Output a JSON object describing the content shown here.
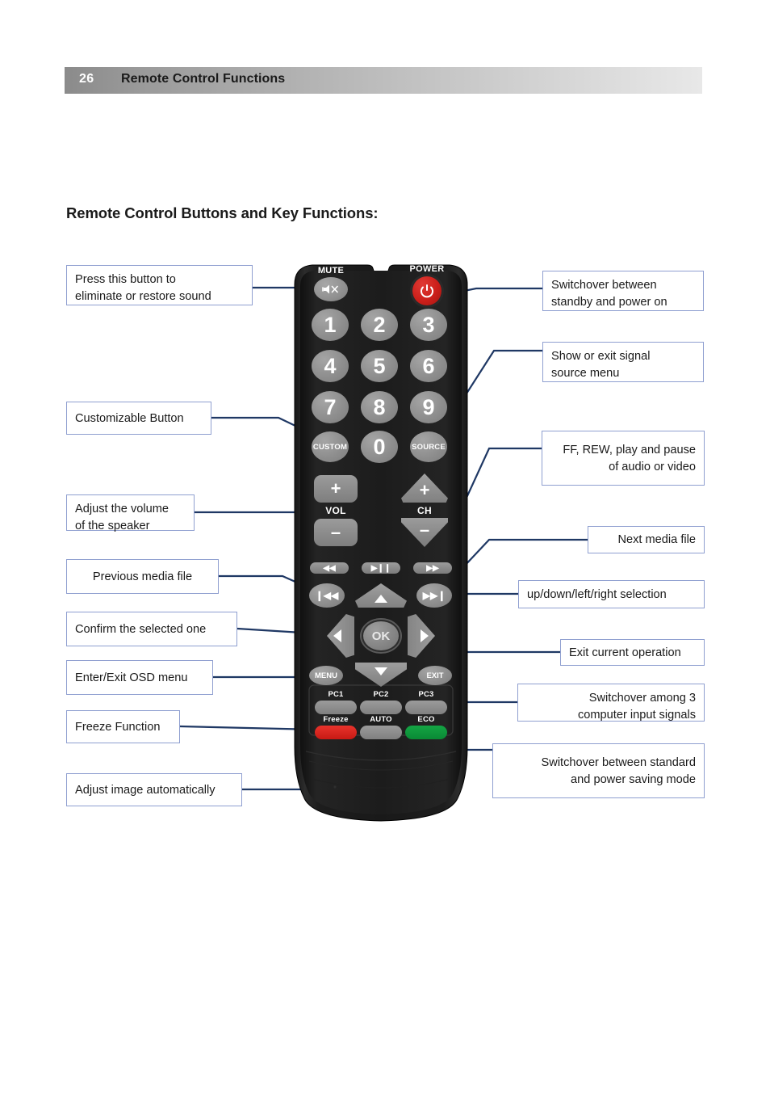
{
  "header": {
    "page_number": "26",
    "title": "Remote Control Functions"
  },
  "section_heading": "Remote Control Buttons and Key Functions:",
  "callouts": {
    "left": [
      {
        "id": "mute",
        "text": "Press this button to\neliminate or restore sound"
      },
      {
        "id": "custom",
        "text": "Customizable Button"
      },
      {
        "id": "volume",
        "text": "Adjust the volume\nof the speaker"
      },
      {
        "id": "previous",
        "text": "Previous media file"
      },
      {
        "id": "ok",
        "text": "Confirm the selected one"
      },
      {
        "id": "menu",
        "text": "Enter/Exit OSD menu"
      },
      {
        "id": "freeze",
        "text": "Freeze Function"
      },
      {
        "id": "auto",
        "text": "Adjust image automatically"
      }
    ],
    "right": [
      {
        "id": "power",
        "text": "Switchover between\nstandby and power on"
      },
      {
        "id": "source",
        "text": "Show or exit signal\nsource menu"
      },
      {
        "id": "transport",
        "text": "FF, REW, play and pause\nof audio or video"
      },
      {
        "id": "next",
        "text": "Next media file"
      },
      {
        "id": "dpad",
        "text": "up/down/left/right selection"
      },
      {
        "id": "exit",
        "text": "Exit current operation"
      },
      {
        "id": "pc",
        "text": "Switchover among 3\ncomputer input signals"
      },
      {
        "id": "eco",
        "text": "Switchover between standard\nand power saving mode"
      }
    ]
  },
  "remote": {
    "mute_label": "MUTE",
    "power_label": "POWER",
    "numbers": [
      "1",
      "2",
      "3",
      "4",
      "5",
      "6",
      "7",
      "8",
      "9"
    ],
    "custom_label": "CUSTOM",
    "zero_label": "0",
    "source_label": "SOURCE",
    "vol_label": "VOL",
    "ch_label": "CH",
    "vol_plus": "+",
    "vol_minus": "–",
    "ch_plus": "+",
    "ch_minus": "–",
    "rew_icon": "◀◀",
    "playpause_icon": "▶❙❙",
    "ff_icon": "▶▶",
    "prev_icon": "❙◀◀",
    "next_icon": "▶▶❙",
    "ok_label": "OK",
    "menu_label": "MENU",
    "exit_label": "EXIT",
    "pc1_label": "PC1",
    "pc2_label": "PC2",
    "pc3_label": "PC3",
    "freeze_label": "Freeze",
    "auto_label": "AUTO",
    "eco_label": "ECO"
  },
  "colors": {
    "connector": "#1F3864",
    "callout_border": "#8f9fd0",
    "power_red": "#cc1f1a",
    "freeze_red": "#e8332c",
    "eco_green": "#14a544",
    "button_gray": "#8c8c8c",
    "remote_body": "#1a1a1a"
  }
}
